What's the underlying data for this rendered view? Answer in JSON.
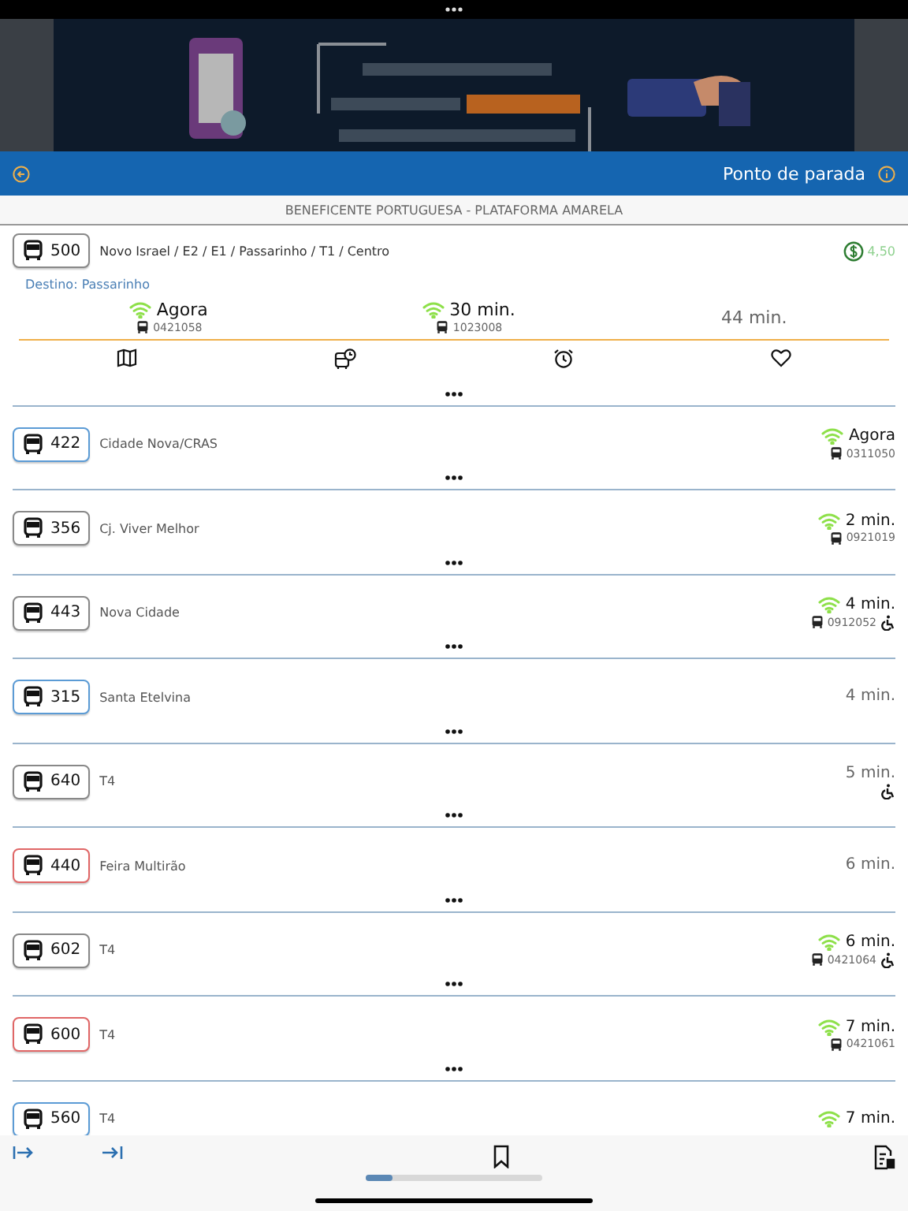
{
  "header": {
    "title": "Ponto de parada"
  },
  "stop_name": "BENEFICENTE PORTUGUESA - PLATAFORMA AMARELA",
  "featured": {
    "route": "500",
    "color": "#888888",
    "name": "Novo Israel / E2 / E1 / Passarinho / T1 / Centro",
    "fare": "4,50",
    "destination": "Destino: Passarinho",
    "arrivals": [
      {
        "time": "Agora",
        "realtime": true,
        "vehicle": "0421058"
      },
      {
        "time": "30 min.",
        "realtime": true,
        "vehicle": "1023008"
      },
      {
        "time": "44 min.",
        "realtime": false
      }
    ]
  },
  "routes": [
    {
      "route": "422",
      "color": "#5b9bd5",
      "name": "Cidade Nova/CRAS",
      "time": "Agora",
      "realtime": true,
      "vehicle": "0311050",
      "accessible": false
    },
    {
      "route": "356",
      "color": "#888888",
      "name": "Cj. Viver Melhor",
      "time": "2 min.",
      "realtime": true,
      "vehicle": "0921019",
      "accessible": false
    },
    {
      "route": "443",
      "color": "#888888",
      "name": "Nova Cidade",
      "time": "4 min.",
      "realtime": true,
      "vehicle": "0912052",
      "accessible": true
    },
    {
      "route": "315",
      "color": "#5b9bd5",
      "name": "Santa Etelvina",
      "time": "4 min.",
      "realtime": false,
      "accessible": false
    },
    {
      "route": "640",
      "color": "#888888",
      "name": "T4",
      "time": "5 min.",
      "realtime": false,
      "accessible": true
    },
    {
      "route": "440",
      "color": "#e06666",
      "name": "Feira Multirão",
      "time": "6 min.",
      "realtime": false,
      "accessible": false
    },
    {
      "route": "602",
      "color": "#888888",
      "name": "T4",
      "time": "6 min.",
      "realtime": true,
      "vehicle": "0421064",
      "accessible": true
    },
    {
      "route": "600",
      "color": "#e06666",
      "name": "T4",
      "time": "7 min.",
      "realtime": true,
      "vehicle": "0421061",
      "accessible": false
    },
    {
      "route": "560",
      "color": "#5b9bd5",
      "name": "T4",
      "time": "7 min.",
      "realtime": true,
      "accessible": false
    }
  ],
  "scroll_progress": {
    "level": 0.15
  }
}
